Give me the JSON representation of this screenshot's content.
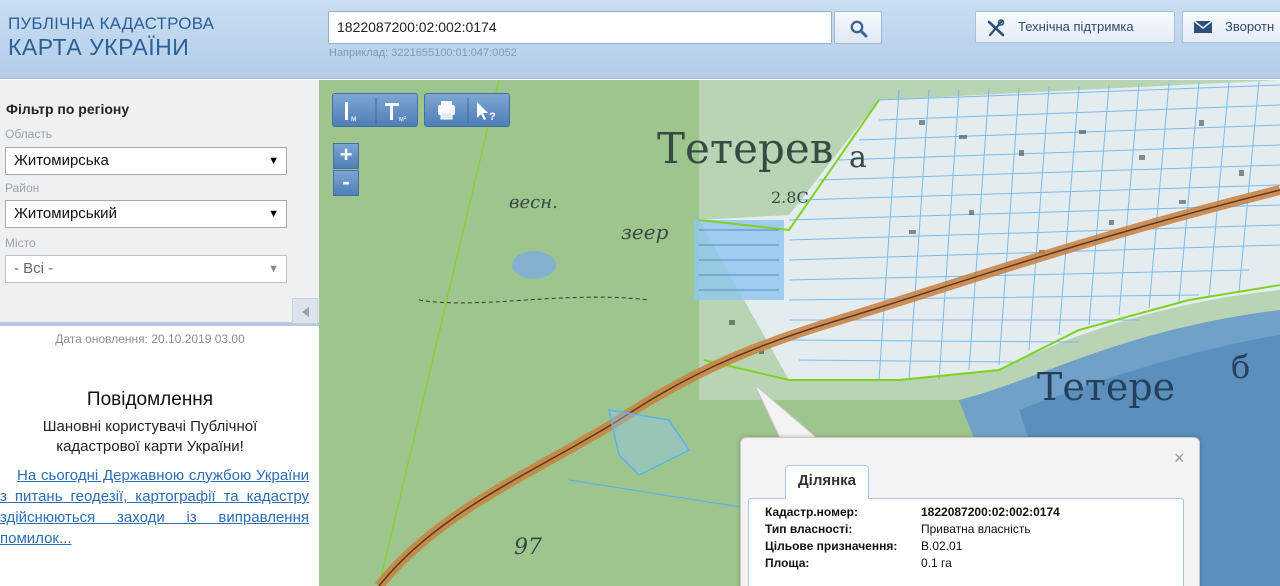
{
  "header": {
    "logo_line1": "ПУБЛІЧНА КАДАСТРОВА",
    "logo_line2": "КАРТА УКРАЇНИ",
    "search_value": "1822087200:02:002:0174",
    "search_hint": "Наприклад: 3221655100:01:047:0052",
    "search_icon": "magnifier-icon",
    "support_label": "Технічна підтримка",
    "support_icon": "tools-icon",
    "feedback_label": "Зворотн",
    "feedback_icon": "envelope-icon"
  },
  "filter": {
    "title": "Фільтр по регіону",
    "oblast_label": "Область",
    "oblast_value": "Житомирська",
    "rayon_label": "Район",
    "rayon_value": "Житомирський",
    "city_label": "Місто",
    "city_value": "- Всі -",
    "arrow": "▼"
  },
  "sidebar": {
    "update_date": "Дата оновлення: 20.10.2019 03.00",
    "notice_title": "Повідомлення",
    "notice_text": "Шановні користувачі Публічної кадастрової карти України!",
    "notice_link": "На сьогодні Державною службою України з питань геодезії, картографії та кадастру здійснюються заходи із виправлення помилок..."
  },
  "map": {
    "zoom_in": "+",
    "zoom_out": "-",
    "tools": [
      "measure-length-icon",
      "measure-area-icon",
      "print-icon",
      "identify-cursor-icon"
    ],
    "labels": {
      "town_top": "Тетерев",
      "town_top_suffix": "а",
      "river_right": "Тетере",
      "river_right2": "б",
      "forest_note": "весн.",
      "forest_note2": "зеер",
      "elev": "2.8С",
      "num": "97"
    }
  },
  "popup": {
    "close": "×",
    "tab": "Ділянка",
    "rows": [
      {
        "key": "Кадастр.номер:",
        "value": "1822087200:02:002:0174"
      },
      {
        "key": "Тип власності:",
        "value": "Приватна власність"
      },
      {
        "key": "Цільове призначення:",
        "value": "В.02.01"
      },
      {
        "key": "Площа:",
        "value": "0.1 га"
      }
    ]
  }
}
